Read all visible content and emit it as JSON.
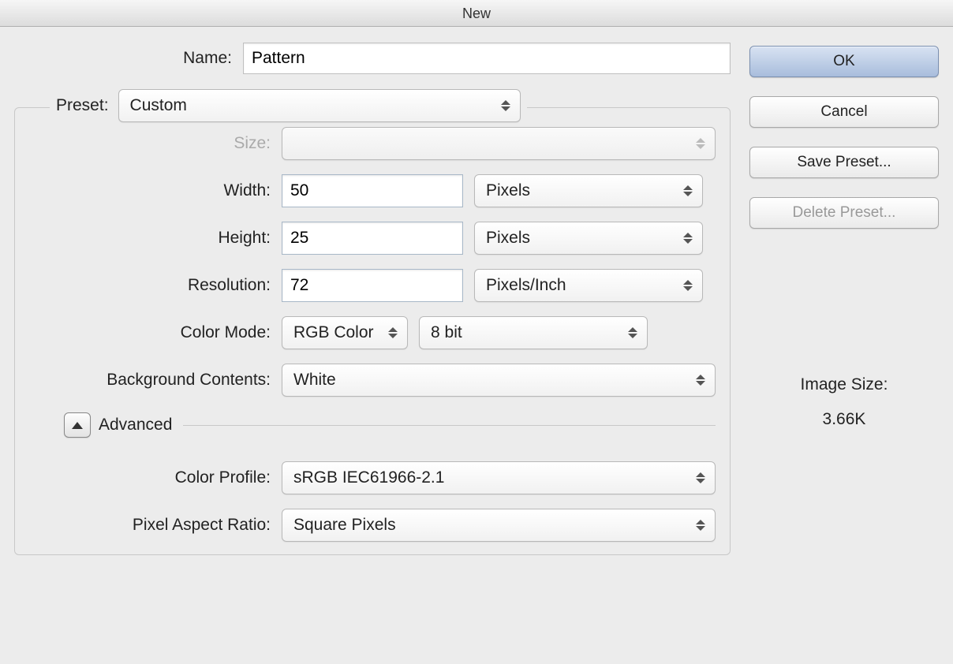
{
  "window": {
    "title": "New"
  },
  "form": {
    "name_label": "Name:",
    "name_value": "Pattern",
    "preset_label": "Preset:",
    "preset_value": "Custom",
    "size_label": "Size:",
    "size_value": "",
    "width_label": "Width:",
    "width_value": "50",
    "width_unit": "Pixels",
    "height_label": "Height:",
    "height_value": "25",
    "height_unit": "Pixels",
    "resolution_label": "Resolution:",
    "resolution_value": "72",
    "resolution_unit": "Pixels/Inch",
    "colormode_label": "Color Mode:",
    "colormode_value": "RGB Color",
    "colordepth_value": "8 bit",
    "bgcontents_label": "Background Contents:",
    "bgcontents_value": "White",
    "advanced_label": "Advanced",
    "colorprofile_label": "Color Profile:",
    "colorprofile_value": "sRGB IEC61966-2.1",
    "pixelaspect_label": "Pixel Aspect Ratio:",
    "pixelaspect_value": "Square Pixels"
  },
  "buttons": {
    "ok": "OK",
    "cancel": "Cancel",
    "save_preset": "Save Preset...",
    "delete_preset": "Delete Preset..."
  },
  "imagesize": {
    "label": "Image Size:",
    "value": "3.66K"
  }
}
